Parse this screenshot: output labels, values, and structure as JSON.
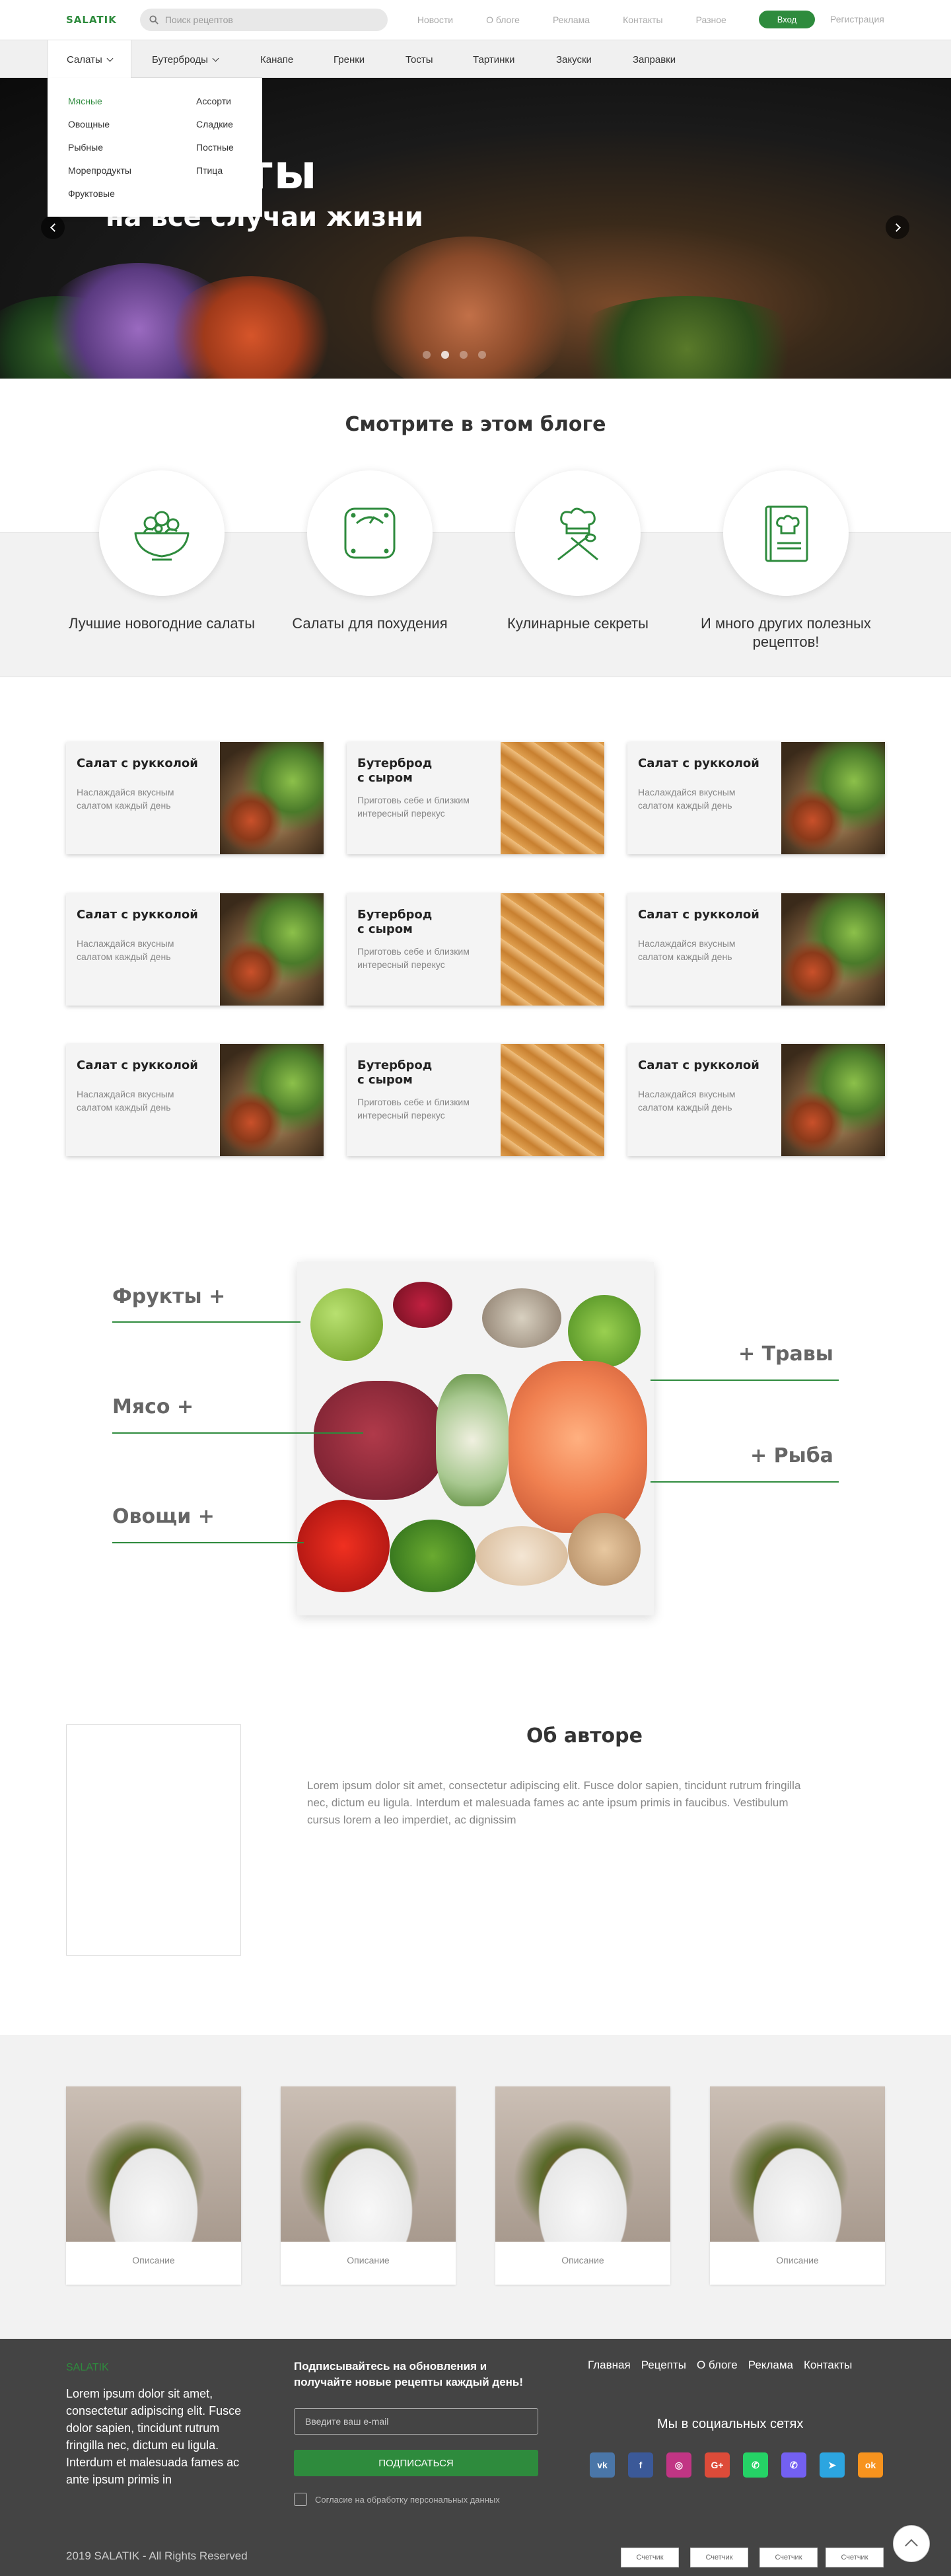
{
  "header": {
    "logo": "SALATIK",
    "search_placeholder": "Поиск рецептов",
    "links": [
      "Новости",
      "О блоге",
      "Реклама",
      "Контакты",
      "Разное"
    ],
    "login_label": "Вход",
    "register_label": "Регистрация"
  },
  "menu": {
    "items": [
      "Салаты",
      "Бутерброды",
      "Канапе",
      "Гренки",
      "Тосты",
      "Тартинки",
      "Закуски",
      "Заправки"
    ],
    "dropdown": {
      "col1": [
        "Мясные",
        "Овощные",
        "Рыбные",
        "Морепродукты",
        "Фруктовые"
      ],
      "col2": [
        "Ассорти",
        "Сладкие",
        "Постные",
        "Птица"
      ]
    }
  },
  "hero": {
    "title": "Салаты",
    "subtitle": "на все случаи жизни"
  },
  "blog": {
    "title": "Смотрите в этом блоге",
    "items": [
      {
        "label": "Лучшие новогодние салаты",
        "icon": "salad-bowl-icon"
      },
      {
        "label": "Салаты для похудения",
        "icon": "scale-icon"
      },
      {
        "label": "Кулинарные секреты",
        "icon": "chef-hat-utensils-icon"
      },
      {
        "label": "И много других полезных рецептов!",
        "icon": "recipe-book-icon"
      }
    ]
  },
  "recipes": [
    {
      "title": "Салат с рукколой",
      "desc": "Наслаждайся вкусным салатом каждый день",
      "image": "salad"
    },
    {
      "title": "Бутерброд с сыром",
      "desc": "Приготовь себе и близким интересный перекус",
      "image": "sandwich"
    },
    {
      "title": "Салат с рукколой",
      "desc": "Наслаждайся вкусным салатом каждый день",
      "image": "salad"
    },
    {
      "title": "Салат с рукколой",
      "desc": "Наслаждайся вкусным салатом каждый день",
      "image": "salad"
    },
    {
      "title": "Бутерброд с сыром",
      "desc": "Приготовь себе и близким интересный перекус",
      "image": "sandwich"
    },
    {
      "title": "Салат с рукколой",
      "desc": "Наслаждайся вкусным салатом каждый день",
      "image": "salad"
    },
    {
      "title": "Салат с рукколой",
      "desc": "Наслаждайся вкусным салатом каждый день",
      "image": "salad"
    },
    {
      "title": "Бутерброд с сыром",
      "desc": "Приготовь себе и близким интересный перекус",
      "image": "sandwich"
    },
    {
      "title": "Салат с рукколой",
      "desc": "Наслаждайся вкусным салатом каждый день",
      "image": "salad"
    }
  ],
  "ingredients": {
    "left": [
      "Фрукты +",
      "Мясо +",
      "Овощи +"
    ],
    "right": [
      "+ Травы",
      "+ Рыба"
    ]
  },
  "about": {
    "title": "Об авторе",
    "text": "Lorem ipsum dolor sit amet, consectetur adipiscing elit. Fusce dolor sapien, tincidunt rutrum fringilla nec, dictum eu ligula. Interdum et malesuada fames ac ante ipsum primis in faucibus. Vestibulum cursus lorem a leo imperdiet, ac dignissim"
  },
  "gallery": {
    "items": [
      "Описание",
      "Описание",
      "Описание",
      "Описание"
    ]
  },
  "footer": {
    "logo": "SALATIK",
    "text": "Lorem ipsum dolor sit amet, consectetur adipiscing elit. Fusce dolor sapien, tincidunt rutrum fringilla nec, dictum eu ligula. Interdum et malesuada fames ac ante ipsum primis in",
    "subscribe_title": "Подписывайтесь на обновления и получайте новые рецепты каждый день!",
    "email_placeholder": "Введите ваш e-mail",
    "subscribe_button": "ПОДПИСАТЬСЯ",
    "consent": "Согласие на обработку персональных данных",
    "nav": [
      "Главная",
      "Рецепты",
      "О блоге",
      "Реклама",
      "Контакты"
    ],
    "social_title": "Мы в социальных сетях",
    "social": [
      {
        "icon": "vk-icon",
        "glyph": "vk",
        "color": "#4a76a8"
      },
      {
        "icon": "facebook-icon",
        "glyph": "f",
        "color": "#3b5998"
      },
      {
        "icon": "instagram-icon",
        "glyph": "◎",
        "color": "#c13584"
      },
      {
        "icon": "google-plus-icon",
        "glyph": "G+",
        "color": "#dd4b39"
      },
      {
        "icon": "whatsapp-icon",
        "glyph": "✆",
        "color": "#25d366"
      },
      {
        "icon": "viber-icon",
        "glyph": "✆",
        "color": "#7360f2"
      },
      {
        "icon": "telegram-icon",
        "glyph": "➤",
        "color": "#2ca5e0"
      },
      {
        "icon": "odnoklassniki-icon",
        "glyph": "ok",
        "color": "#f7931e"
      }
    ],
    "copyright": "2019 SALATIK - All Rights Reserved",
    "counters": [
      "Счетчик",
      "Счетчик",
      "Счетчик",
      "Счетчик"
    ]
  },
  "colors": {
    "accent": "#2e8b3d",
    "footer_bg": "#444444",
    "band_bg": "#f2f2f2"
  }
}
